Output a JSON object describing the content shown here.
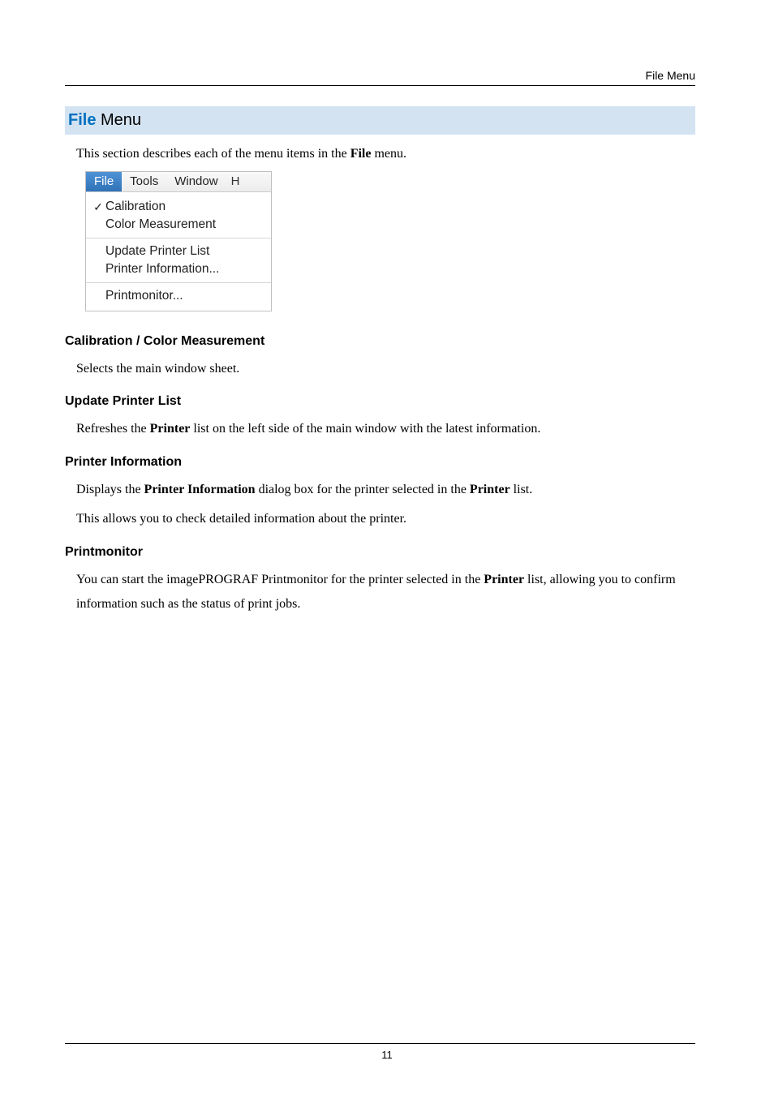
{
  "header": {
    "label": "File Menu"
  },
  "title": {
    "file": "File",
    "menu": " Menu"
  },
  "intro": {
    "pre": "This section describes each of the menu items in the ",
    "bold": "File",
    "post": " menu."
  },
  "menushot": {
    "menubar": {
      "file": "File",
      "tools": "Tools",
      "window": "Window",
      "cut": "H"
    },
    "items": {
      "calibration_check": "✓",
      "calibration": "Calibration",
      "color_measurement": "Color Measurement",
      "update_printer_list": "Update Printer List",
      "printer_information": "Printer Information...",
      "printmonitor": "Printmonitor..."
    }
  },
  "sections": {
    "calib": {
      "heading": "Calibration / Color Measurement",
      "body": "Selects the main window sheet."
    },
    "update": {
      "heading": "Update Printer List",
      "body_pre": "Refreshes the ",
      "body_bold": "Printer",
      "body_post": " list on the left side of the main window with the latest information."
    },
    "printerinfo": {
      "heading": "Printer Information",
      "p1_pre": "Displays the ",
      "p1_b1": "Printer Information",
      "p1_mid": " dialog box for the printer selected in the ",
      "p1_b2": "Printer",
      "p1_post": " list.",
      "p2": "This allows you to check detailed information about the printer."
    },
    "printmon": {
      "heading": "Printmonitor",
      "body_pre": "You can start the imagePROGRAF Printmonitor for the printer selected in the ",
      "body_bold": "Printer",
      "body_post": " list, allowing you to confirm information such as the status of print jobs."
    }
  },
  "pageNumber": "11"
}
